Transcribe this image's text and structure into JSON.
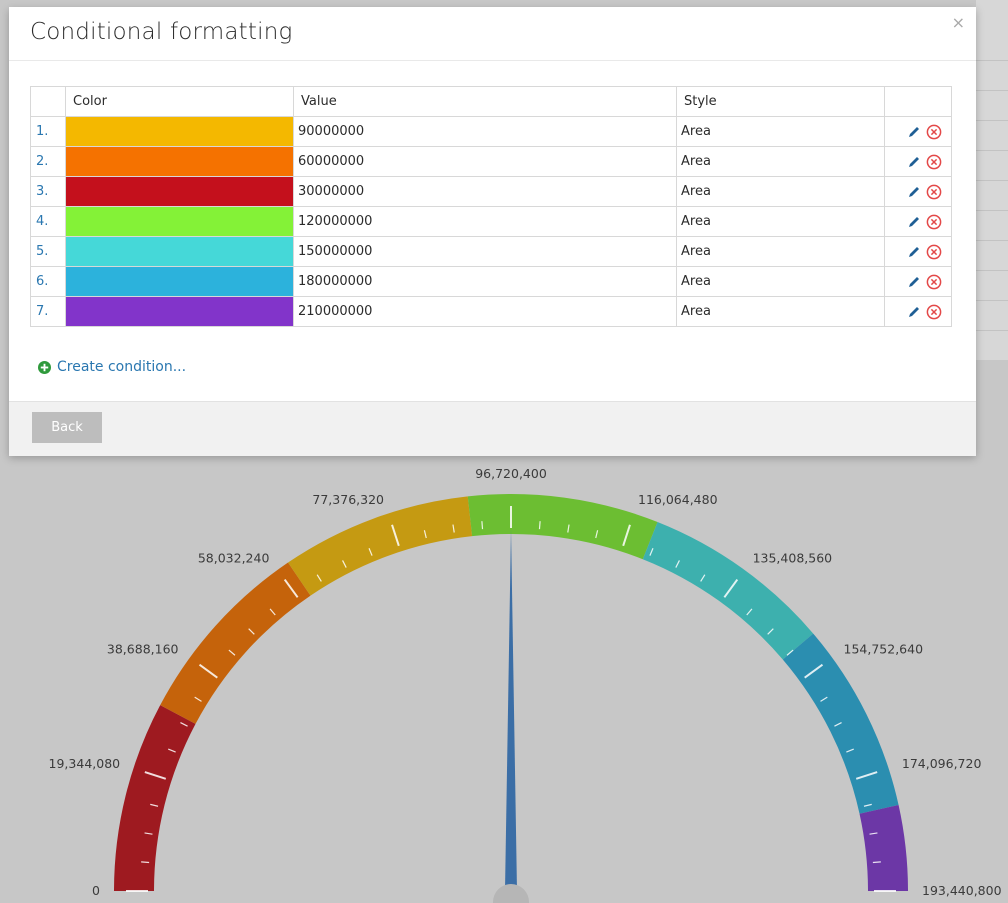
{
  "dialog": {
    "title": "Conditional formatting",
    "close_glyph": "×",
    "columns": [
      "",
      "Color",
      "Value",
      "Style",
      ""
    ],
    "rows": [
      {
        "index": "1.",
        "color": "#f4b800",
        "value": "90000000",
        "style": "Area"
      },
      {
        "index": "2.",
        "color": "#f57200",
        "value": "60000000",
        "style": "Area"
      },
      {
        "index": "3.",
        "color": "#c4101c",
        "value": "30000000",
        "style": "Area"
      },
      {
        "index": "4.",
        "color": "#84f237",
        "value": "120000000",
        "style": "Area"
      },
      {
        "index": "5.",
        "color": "#45d8d8",
        "value": "150000000",
        "style": "Area"
      },
      {
        "index": "6.",
        "color": "#2cb2dc",
        "value": "180000000",
        "style": "Area"
      },
      {
        "index": "7.",
        "color": "#8234ca",
        "value": "210000000",
        "style": "Area"
      }
    ],
    "row_icons": [
      "pencil-icon",
      "remove-circle-icon"
    ],
    "create_label": "Create condition...",
    "back_label": "Back"
  },
  "gauge": {
    "type": "gauge",
    "min": 0,
    "max": 193440800,
    "value": 96720400,
    "tick_labels": [
      "0",
      "19,344,080",
      "38,688,160",
      "58,032,240",
      "77,376,320",
      "96,720,400",
      "116,064,480",
      "135,408,560",
      "154,752,640",
      "174,096,720",
      "193,440,800"
    ],
    "bands": [
      {
        "from": 0,
        "to": 30000000,
        "color": "#9e1a20"
      },
      {
        "from": 30000000,
        "to": 60000000,
        "color": "#c5630b"
      },
      {
        "from": 60000000,
        "to": 90000000,
        "color": "#c59a12"
      },
      {
        "from": 90000000,
        "to": 120000000,
        "color": "#6cbe32"
      },
      {
        "from": 120000000,
        "to": 150000000,
        "color": "#3db0ae"
      },
      {
        "from": 150000000,
        "to": 180000000,
        "color": "#2b8eb0"
      },
      {
        "from": 180000000,
        "to": 193440800,
        "color": "#6c37a6"
      }
    ],
    "needle_color": "#3b6ea6",
    "hub_color": "#b6b6b6"
  }
}
